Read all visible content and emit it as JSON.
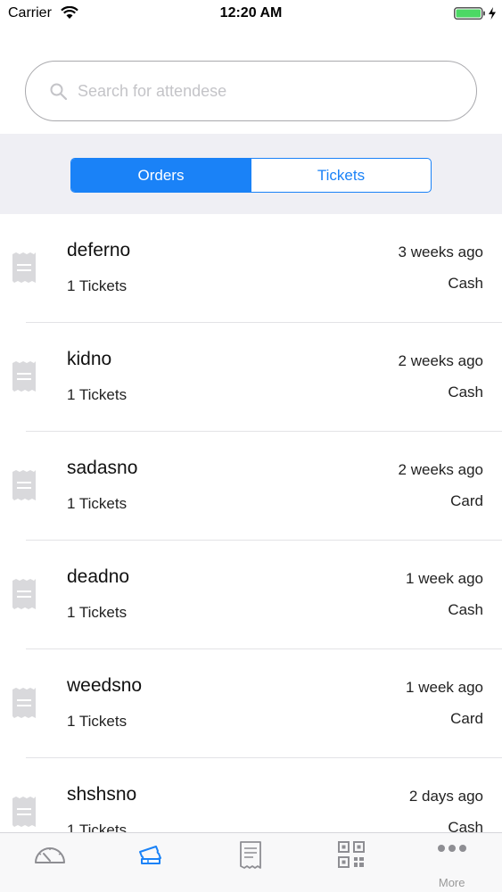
{
  "status_bar": {
    "carrier": "Carrier",
    "time": "12:20 AM",
    "battery_color": "#4cd964"
  },
  "search": {
    "placeholder": "Search for attendese",
    "value": ""
  },
  "segments": {
    "items": [
      {
        "label": "Orders",
        "active": true
      },
      {
        "label": "Tickets",
        "active": false
      }
    ],
    "accent_color": "#1a82f7"
  },
  "orders": [
    {
      "name": "deferno",
      "tickets": "1 Tickets",
      "time": "3 weeks ago",
      "method": "Cash"
    },
    {
      "name": "kidno",
      "tickets": "1 Tickets",
      "time": "2 weeks ago",
      "method": "Cash"
    },
    {
      "name": "sadasno",
      "tickets": "1 Tickets",
      "time": "2 weeks ago",
      "method": "Card"
    },
    {
      "name": "deadno",
      "tickets": "1 Tickets",
      "time": "1 week ago",
      "method": "Cash"
    },
    {
      "name": "weedsno",
      "tickets": "1 Tickets",
      "time": "1 week ago",
      "method": "Card"
    },
    {
      "name": "shshsno",
      "tickets": "1 Tickets",
      "time": "2 days ago",
      "method": "Cash"
    }
  ],
  "tab_bar": {
    "items": [
      {
        "icon": "dashboard-gauge-icon",
        "label": ""
      },
      {
        "icon": "tickets-icon",
        "label": "",
        "active": true
      },
      {
        "icon": "receipt-list-icon",
        "label": ""
      },
      {
        "icon": "qr-code-icon",
        "label": ""
      },
      {
        "icon": "more-dots-icon",
        "label": "More"
      }
    ]
  }
}
